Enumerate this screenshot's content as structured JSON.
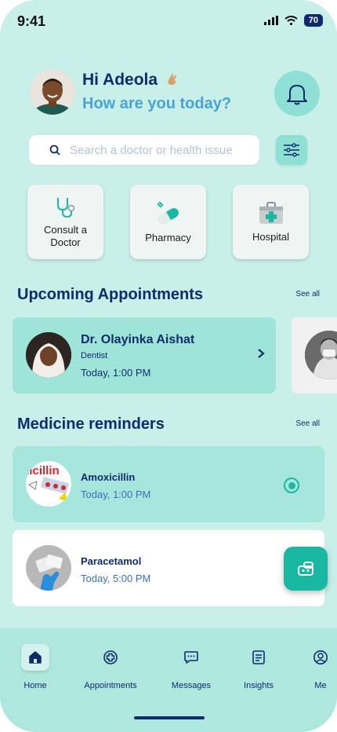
{
  "status_bar": {
    "time": "9:41",
    "battery": "70"
  },
  "greeting": {
    "hello": "Hi Adeola",
    "subtitle": "How are you today?"
  },
  "search": {
    "placeholder": "Search a doctor or health issue"
  },
  "quick_actions": [
    {
      "label": "Consult a Doctor",
      "icon": "stethoscope-icon"
    },
    {
      "label": "Pharmacy",
      "icon": "pill-icon"
    },
    {
      "label": "Hospital",
      "icon": "first-aid-kit-icon"
    }
  ],
  "appointments": {
    "title": "Upcoming Appointments",
    "see_all": "See all",
    "items": [
      {
        "doctor": "Dr. Olayinka Aishat",
        "specialty": "Dentist",
        "time": "Today, 1:00 PM"
      }
    ]
  },
  "medicine": {
    "title": "Medicine reminders",
    "see_all": "See all",
    "items": [
      {
        "name": "Amoxicillin",
        "time": "Today, 1:00 PM",
        "selected": true,
        "image_text": "xicillin"
      },
      {
        "name": "Paracetamol",
        "time": "Today, 5:00 PM",
        "selected": false
      }
    ]
  },
  "nav": {
    "home": "Home",
    "appointments": "Appointments",
    "messages": "Messages",
    "insights": "Insights",
    "me": "Me"
  },
  "colors": {
    "primary_dark": "#0f2b6d",
    "accent_teal": "#19b8a3",
    "link_blue": "#4aa3d6",
    "background": "#c9efe9"
  }
}
